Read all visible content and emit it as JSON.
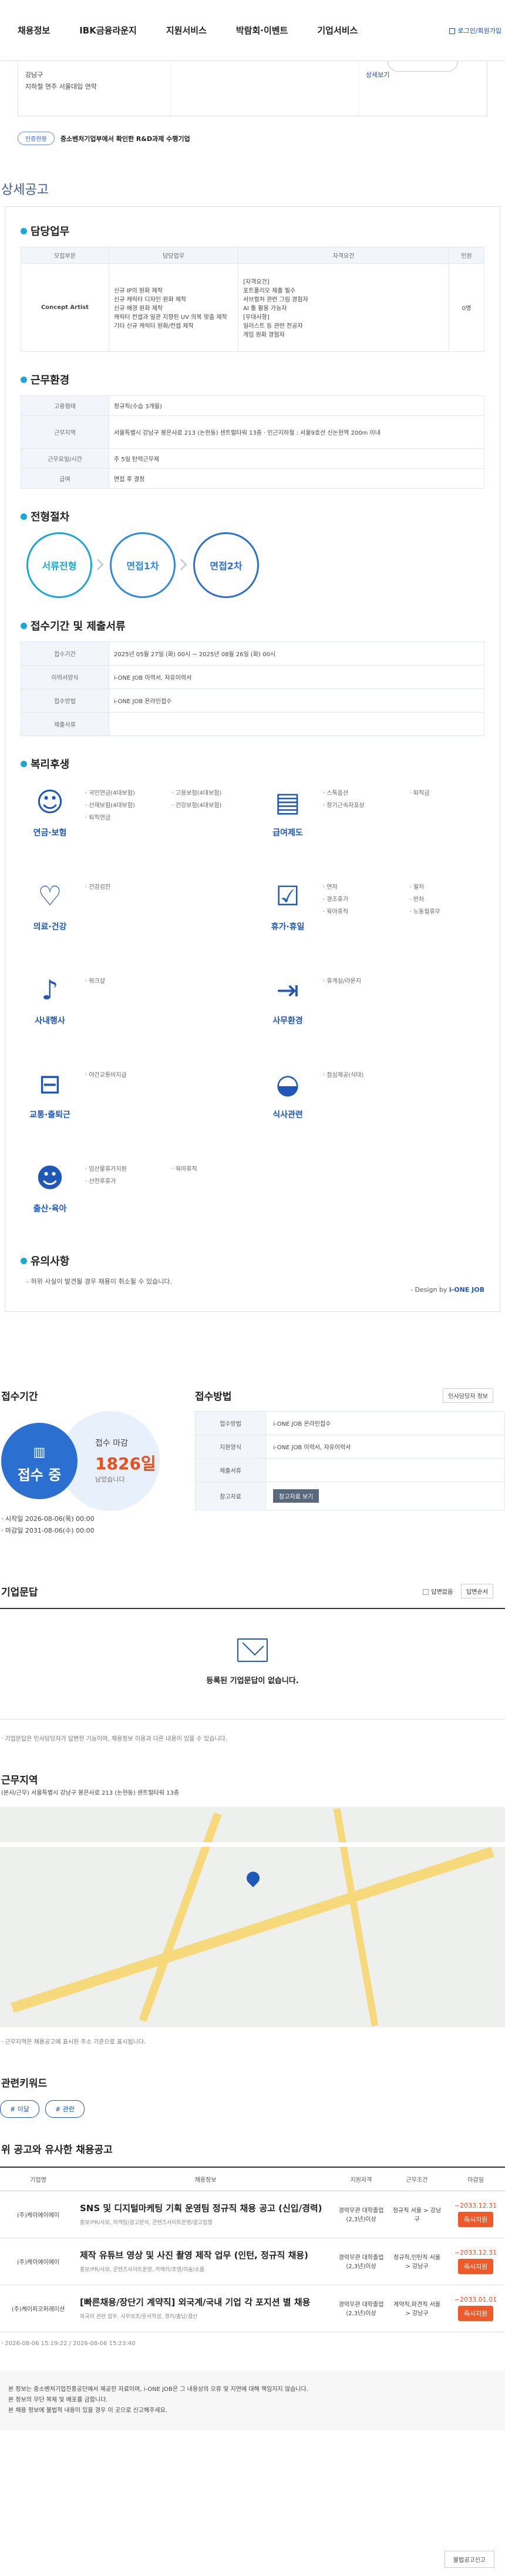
{
  "nav": {
    "items": [
      "채용정보",
      "IBK금융라운지",
      "지원서비스",
      "박람회·이벤트",
      "기업서비스"
    ],
    "login": "로그인/회원가입"
  },
  "address": {
    "line1": "강남구",
    "line2": "지하철 연주 서울대입 연락",
    "link": "상세보기"
  },
  "cert": {
    "badge": "인증현황",
    "text": "중소벤처기업부에서 확인한 R&D과제 수행기업"
  },
  "detail_title": "상세공고",
  "duties": {
    "heading": "담당업무",
    "headers": [
      "모집부문",
      "담당업무",
      "자격요건",
      "인원"
    ],
    "part": "Concept Artist",
    "tasks": [
      "신규 IP의 원화 제작",
      "신규 캐릭터 디자인 원화 제작",
      "신규 배경 원화 제작",
      "캐릭터 컨셉과 일관 지향된 UV 의복 맞춤 제작",
      "기타 신규 캐릭터 원화/컨셉 제작"
    ],
    "requirements": [
      "[자격요건]",
      "포트폴리오 제출 필수",
      "서브컬처 관련 그림 경험자",
      "AI 툴 활용 가능자",
      "[우대사항]",
      "일러스트 등 관련 전공자",
      "게임 원화 경험자"
    ],
    "count": "0명"
  },
  "conditions": {
    "heading": "근무환경",
    "rows": [
      {
        "k": "고용형태",
        "v": "정규직(수습 3개월)"
      },
      {
        "k": "근무지역",
        "v": "서울특별시 강남구 봉은사로 213 (논현동) 센트럴타워 13층 · 인근지하철 : 서울9호선 신논현역 200m 이내"
      },
      {
        "k": "근무요일/시간",
        "v": "주 5일 탄력근무제"
      },
      {
        "k": "급여",
        "v": "면접 후 결정"
      }
    ]
  },
  "process": {
    "heading": "전형절차",
    "steps": [
      "서류전형",
      "면접1차",
      "면접2차"
    ]
  },
  "apply_info": {
    "heading": "접수기간 및 제출서류",
    "rows": [
      {
        "k": "접수기간",
        "v": "2025년 05월 27일 (화) 00시 ~ 2025년 08월 26일 (화) 00시"
      },
      {
        "k": "이력서양식",
        "v": "i-ONE JOB 이력서, 자유이력서"
      },
      {
        "k": "접수방법",
        "v": "i-ONE JOB 온라인접수"
      },
      {
        "k": "제출서류",
        "v": ""
      }
    ]
  },
  "benefits": {
    "heading": "복리후생",
    "groups": [
      {
        "label": "연금·보험",
        "icon": "piggy-icon",
        "glyph": "☺",
        "items": [
          "국민연금(4대보험)",
          "고용보험(4대보험)",
          "산재보험(4대보험)",
          "건강보험(4대보험)",
          "퇴직연금"
        ]
      },
      {
        "label": "급여제도",
        "icon": "money-icon",
        "glyph": "▤",
        "items": [
          "스톡옵션",
          "퇴직금",
          "장기근속자포상"
        ]
      },
      {
        "label": "의료·건강",
        "icon": "heart-icon",
        "glyph": "♡",
        "items": [
          "건강검진"
        ]
      },
      {
        "label": "휴가·휴일",
        "icon": "calendar-icon",
        "glyph": "☑",
        "items": [
          "연차",
          "월차",
          "경조휴가",
          "반차",
          "육아휴직",
          "노동절휴무"
        ]
      },
      {
        "label": "사내행사",
        "icon": "mic-icon",
        "glyph": "♪",
        "items": [
          "워크샵"
        ]
      },
      {
        "label": "사무환경",
        "icon": "monitor-icon",
        "glyph": "⇥",
        "items": [
          "휴게실/라운지"
        ]
      },
      {
        "label": "교통·출퇴근",
        "icon": "bus-icon",
        "glyph": "⊟",
        "items": [
          "야간교통비지급"
        ]
      },
      {
        "label": "식사관련",
        "icon": "bowl-icon",
        "glyph": "◒",
        "items": [
          "점심제공(식대)"
        ]
      },
      {
        "label": "출산·육아",
        "icon": "baby-icon",
        "glyph": "☻",
        "items": [
          "임산물휴가지원",
          "육아휴직",
          "산전후휴가"
        ]
      }
    ]
  },
  "caution": {
    "heading": "유의사항",
    "text": "- 허위 사실이 발견될 경우 채용이 취소될 수 있습니다.",
    "design_prefix": "- Design by ",
    "design_brand": "i-ONE JOB"
  },
  "receipt": {
    "heading": "접수기간",
    "status": "접수 중",
    "deadline_label": "접수 마감",
    "dday": "1826일",
    "remain": "남았습니다",
    "start": "· 시작일 2026-08-06(목) 00:00",
    "end": "· 마감일 2031-08-06(수) 00:00"
  },
  "method": {
    "heading": "접수방법",
    "select": "인사담당자 정보",
    "rows": [
      {
        "k": "접수방법",
        "v": "i-ONE JOB 온라인접수"
      },
      {
        "k": "지원양식",
        "v": "i-ONE JOB 이력서, 자유이력서"
      },
      {
        "k": "제출서류",
        "v": ""
      },
      {
        "k": "참고자료",
        "v": "참고자료 보기"
      }
    ]
  },
  "qa": {
    "heading": "기업문답",
    "anon": "답변없음",
    "sort": "답변순서",
    "empty": "등록된 기업문답이 없습니다.",
    "note": "· 기업문답은 인사담당자가 답변한 기능이며, 채용정보 이용과 다른 내용이 있을 수 있습니다."
  },
  "location": {
    "heading": "근무지역",
    "addr": "(본사/근무) 서울특별시 강남구 봉은사로 213 (논현동) 센트럴타워 13층",
    "note": "· 근무지역은 채용공고에 표시된 주소 기준으로 표시됩니다."
  },
  "keywords": {
    "heading": "관련키워드",
    "items": [
      "# 이달",
      "# 관련"
    ]
  },
  "similar": {
    "heading": "위 공고와 유사한 채용공고",
    "headers": [
      "기업명",
      "채용정보",
      "지원자격",
      "근무조건",
      "마감일"
    ],
    "rows": [
      {
        "company": "(주)케이에이에이",
        "title": "SNS 및 디지털마케팅 기획 운영팀 정규직 채용 공고 (신입/경력)",
        "sub": "홍보/PR/사보, 마케팅/광고분석, 콘텐츠사이트운영/광고집행",
        "qual": "경력무관 대학졸업(2,3년)이상",
        "cond": "정규직 서울 > 강남구",
        "deadline": "~2033.12.31",
        "btn": "즉시지원"
      },
      {
        "company": "(주)케이에이에이",
        "title": "제작 유튜브 영상 및 사진 촬영 제작 업무 (인턴, 정규직 채용)",
        "sub": "홍보/PR/사보, 콘텐츠사이트운영, 카메라/조명/미술/소품",
        "qual": "경력무관 대학졸업(2,3년)이상",
        "cond": "정규직,인턴직 서울 > 강남구",
        "deadline": "~2033.12.31",
        "btn": "즉시지원"
      },
      {
        "company": "(주)케이피코퍼레이션",
        "title": "[빠른채용/장단기 계약직] 외국계/국내 기업 각 포지션 별 채용",
        "sub": "외국어 관련 업무, 사무보조/문서작성, 경리/출납/결산",
        "qual": "경력무관 대학졸업(2,3년)이상",
        "cond": "계약직,파견직 서울 > 강남구",
        "deadline": "~2033.01.01",
        "btn": "즉시지원"
      }
    ]
  },
  "stamp": "· 2026-08-06 15:19:22 / 2026-08-06 15:23:40",
  "footer": {
    "lines": [
      "본 정보는 중소벤처기업진흥공단에서 제공한 자료이며, i-ONE JOB은 그 내용상의 오류 및 지연에 대해 책임지지 않습니다.",
      "본 정보의 무단 복제 및 배포를 금합니다.",
      "본 채용 정보에 불법적 내용이 있을 경우 이 곳으로 신고해주세요."
    ],
    "report": "불법공고신고"
  }
}
